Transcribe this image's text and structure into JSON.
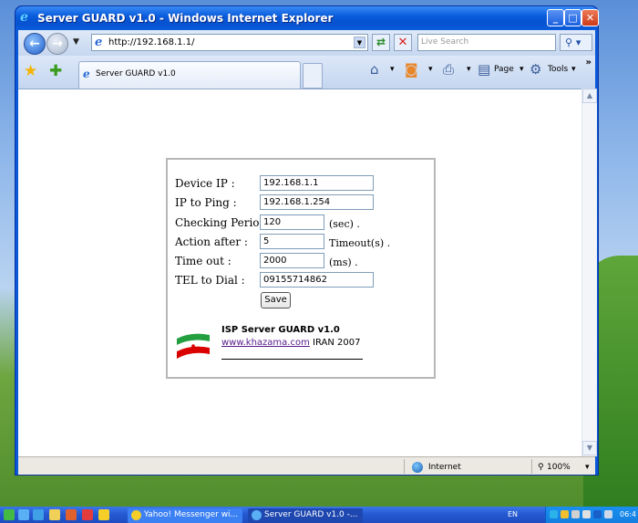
{
  "window": {
    "title": "Server GUARD v1.0 - Windows Internet Explorer"
  },
  "toolbar": {
    "address": "http://192.168.1.1/",
    "search_placeholder": "Live Search",
    "tab_label": "Server GUARD v1.0",
    "page_menu": "Page",
    "tools_menu": "Tools"
  },
  "form": {
    "rows": [
      {
        "label": "Device IP :",
        "value": "192.168.1.1",
        "unit": ""
      },
      {
        "label": "IP to Ping :",
        "value": "192.168.1.254",
        "unit": ""
      },
      {
        "label": "Checking Period :",
        "value": "120",
        "unit": "(sec) ."
      },
      {
        "label": "Action after :",
        "value": "5",
        "unit": "Timeout(s) ."
      },
      {
        "label": "Time out :",
        "value": "2000",
        "unit": "(ms) ."
      },
      {
        "label": "TEL to Dial :",
        "value": "09155714862",
        "unit": ""
      }
    ],
    "save_label": "Save"
  },
  "branding": {
    "title": "ISP Server GUARD v1.0",
    "link": "www.khazama.com",
    "location_year": "IRAN 2007",
    "flag_colors": [
      "#239f40",
      "#ffffff",
      "#da0000"
    ]
  },
  "statusbar": {
    "zone": "Internet",
    "zoom": "100%"
  },
  "taskbar": {
    "tasks": [
      "Yahoo! Messenger wi...",
      "Server GUARD v1.0 -..."
    ],
    "language": "EN",
    "clock": "06:4"
  }
}
